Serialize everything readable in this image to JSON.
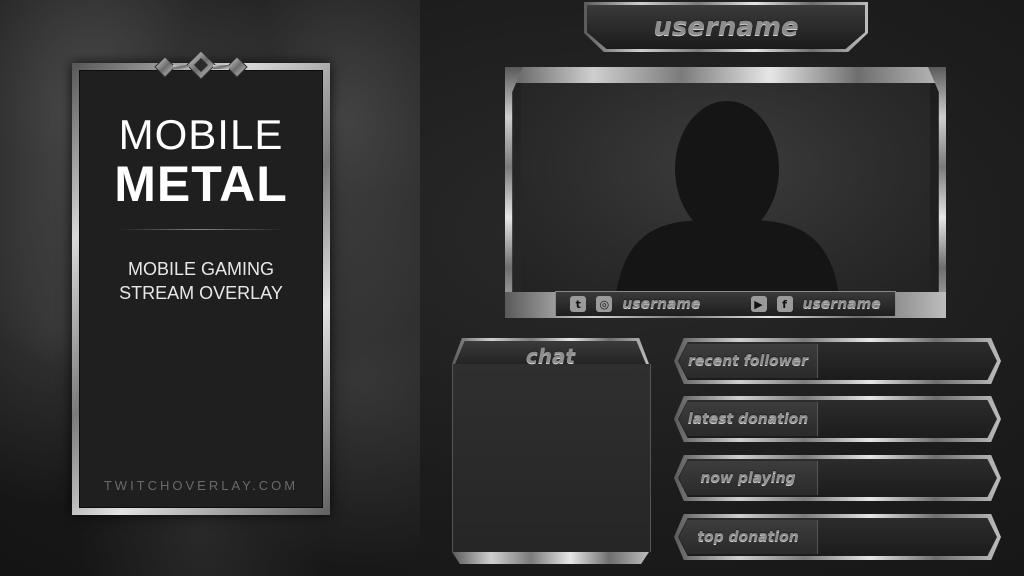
{
  "brand": {
    "title_line1": "MOBILE",
    "title_line2": "METAL",
    "subtitle_line1": "MOBILE GAMING",
    "subtitle_line2": "STREAM OVERLAY",
    "website": "TWITCHOVERLAY.COM"
  },
  "header": {
    "username": "username"
  },
  "webcam": {
    "social": [
      {
        "icons": [
          "twitter-icon",
          "instagram-icon"
        ],
        "handle": "username"
      },
      {
        "icons": [
          "youtube-icon",
          "facebook-icon"
        ],
        "handle": "username"
      }
    ]
  },
  "chat": {
    "title": "chat"
  },
  "alerts": [
    {
      "label": "recent follower"
    },
    {
      "label": "latest donation"
    },
    {
      "label": "now playing"
    },
    {
      "label": "top donation"
    }
  ],
  "colors": {
    "background": "#1c1c1c",
    "metal_light": "#e6e6e6",
    "metal_dark": "#5a5a5a",
    "panel": "#2a2a2a"
  }
}
